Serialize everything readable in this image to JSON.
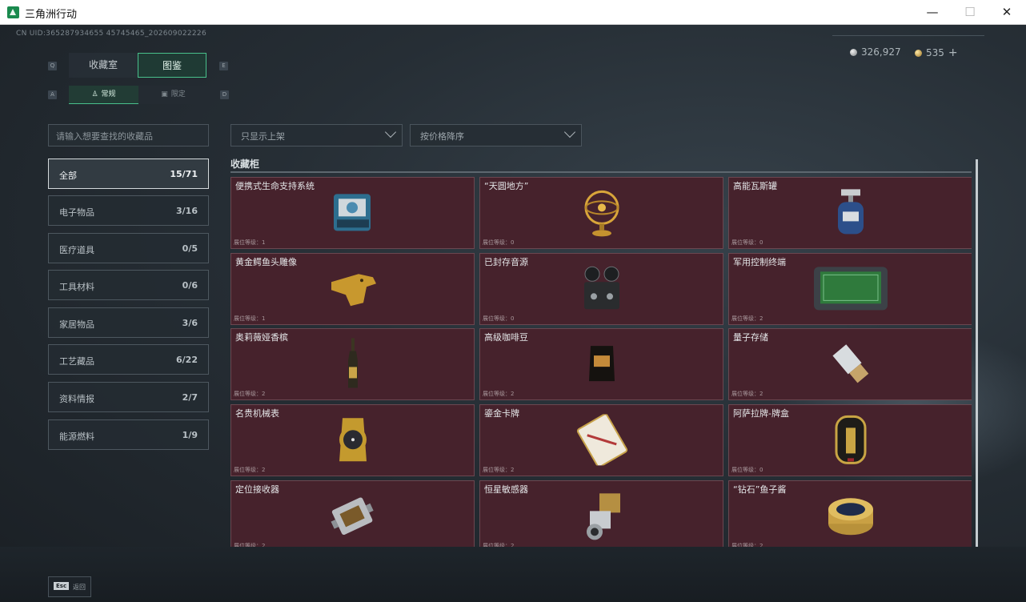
{
  "window": {
    "title": "三角洲行动",
    "minimize": "—",
    "maximize": "☐",
    "close": "✕"
  },
  "uid": "CN UID:365287934655 45745465_202609022226",
  "currency": {
    "silver": "326,927",
    "gold": "535",
    "plus": "+"
  },
  "tabs": {
    "key_left": "Q",
    "key_right": "E",
    "items": [
      "收藏室",
      "图鉴"
    ],
    "active": 1
  },
  "subtabs": {
    "key_left": "A",
    "key_right": "D",
    "items": [
      "常规",
      "限定"
    ],
    "active": 0
  },
  "search": {
    "placeholder": "请输入想要查找的收藏品"
  },
  "categories": [
    {
      "name": "全部",
      "count": "15/71"
    },
    {
      "name": "电子物品",
      "count": "3/16"
    },
    {
      "name": "医疗道具",
      "count": "0/5"
    },
    {
      "name": "工具材料",
      "count": "0/6"
    },
    {
      "name": "家居物品",
      "count": "3/6"
    },
    {
      "name": "工艺藏品",
      "count": "6/22"
    },
    {
      "name": "资料情报",
      "count": "2/7"
    },
    {
      "name": "能源燃料",
      "count": "1/9"
    }
  ],
  "filters": {
    "shelf": "只显示上架",
    "sort": "按价格降序"
  },
  "section": {
    "title": "收藏柜"
  },
  "items": [
    {
      "name": "便携式生命支持系统",
      "level": "展位等级：1",
      "icon": "life-support-icon"
    },
    {
      "name": "“天圆地方”",
      "level": "展位等级：0",
      "icon": "armillary-icon"
    },
    {
      "name": "高能瓦斯罐",
      "level": "展位等级：0",
      "icon": "gas-canister-icon"
    },
    {
      "name": "黄金鳄鱼头雕像",
      "level": "展位等级：1",
      "icon": "croc-statue-icon"
    },
    {
      "name": "已封存音源",
      "level": "展位等级：0",
      "icon": "tape-recorder-icon"
    },
    {
      "name": "军用控制终端",
      "level": "展位等级：2",
      "icon": "control-terminal-icon"
    },
    {
      "name": "奥莉薇娅香槟",
      "level": "展位等级：2",
      "icon": "champagne-icon"
    },
    {
      "name": "高级咖啡豆",
      "level": "展位等级：2",
      "icon": "coffee-bag-icon"
    },
    {
      "name": "量子存储",
      "level": "展位等级：2",
      "icon": "usb-drive-icon"
    },
    {
      "name": "名贵机械表",
      "level": "展位等级：2",
      "icon": "watch-icon"
    },
    {
      "name": "鎏金卡牌",
      "level": "展位等级：2",
      "icon": "gilded-card-icon"
    },
    {
      "name": "阿萨拉牌-牌盒",
      "level": "展位等级：0",
      "icon": "card-box-icon"
    },
    {
      "name": "定位接收器",
      "level": "展位等级：2",
      "icon": "receiver-icon"
    },
    {
      "name": "恒星敏感器",
      "level": "展位等级：2",
      "icon": "star-sensor-icon"
    },
    {
      "name": "“钻石”鱼子酱",
      "level": "展位等级：2",
      "icon": "caviar-tin-icon"
    }
  ],
  "footer": {
    "key": "Esc",
    "label": "返回"
  }
}
